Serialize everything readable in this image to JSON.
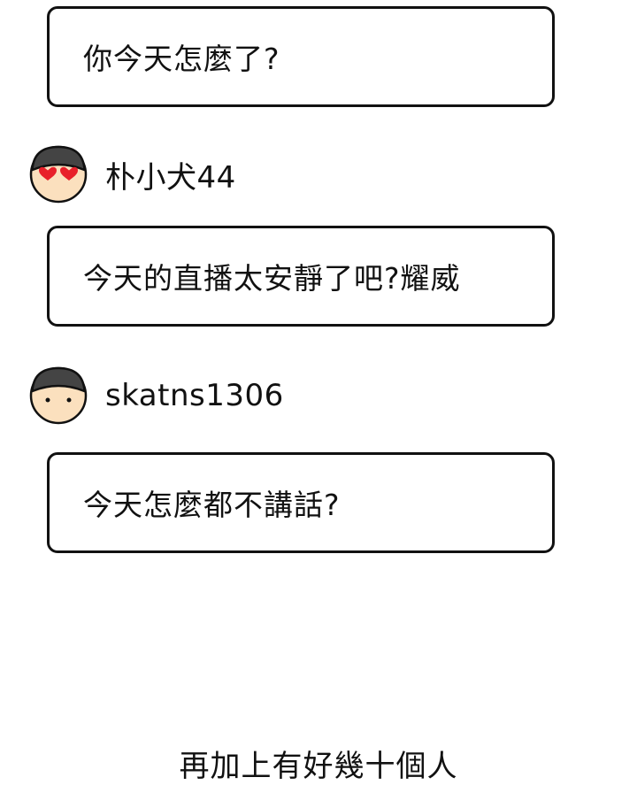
{
  "comments": [
    {
      "text": "你今天怎麼了?"
    },
    {
      "username": "朴小犬44",
      "avatar": "heart-eyes-avatar-icon",
      "text": "今天的直播太安靜了吧?耀威"
    },
    {
      "username": "skatns1306",
      "avatar": "plain-face-avatar-icon",
      "text": "今天怎麼都不講話?"
    }
  ],
  "caption": "再加上有好幾十個人",
  "colors": {
    "outline": "#111111",
    "hair": "#444444",
    "skin": "#fbe0be",
    "heart": "#e8202a"
  }
}
